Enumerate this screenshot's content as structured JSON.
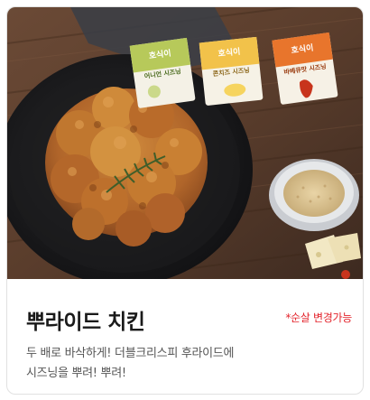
{
  "product": {
    "title": "뿌라이드 치킨",
    "badge": "*순살 변경가능",
    "description_lines": [
      "두 배로 바삭하게! 더블크리스피 후라이드에",
      "시즈닝을 뿌려! 뿌려!"
    ]
  },
  "packets": [
    {
      "brand": "호식이",
      "name": "어니언 시즈닝",
      "color": "#b7c95a"
    },
    {
      "brand": "호식이",
      "name": "콘치즈 시즈닝",
      "color": "#f2c24a"
    },
    {
      "brand": "호식이",
      "name": "바베큐맛 시즈닝",
      "color": "#e8752c"
    }
  ]
}
